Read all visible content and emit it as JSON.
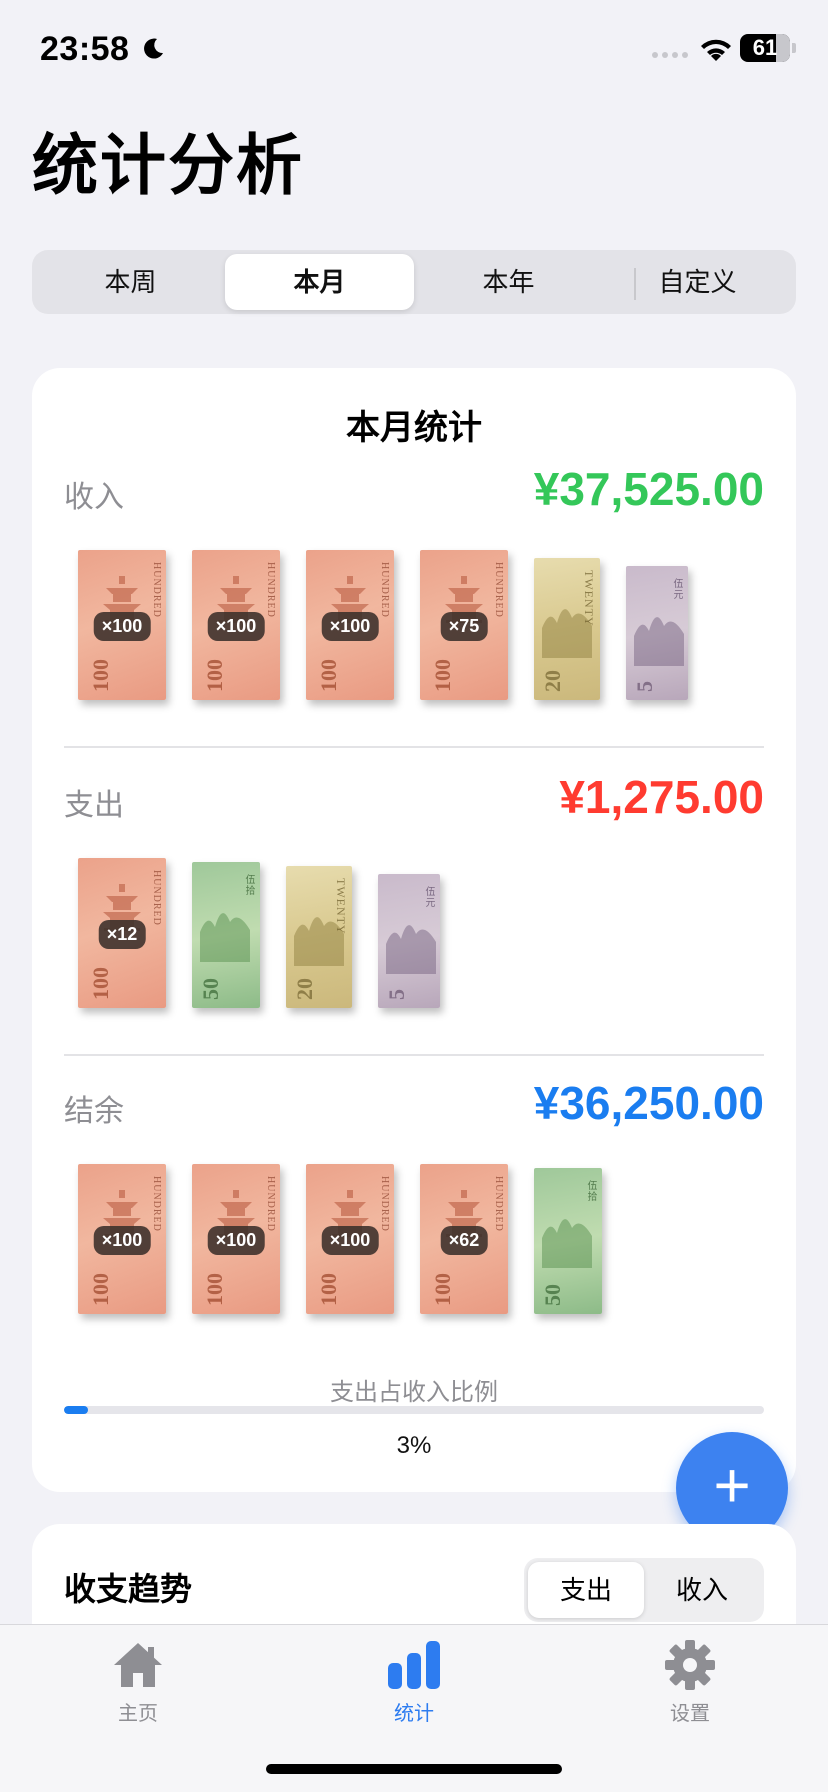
{
  "status": {
    "time": "23:58",
    "battery": "61"
  },
  "title": "统计分析",
  "segments": [
    "本周",
    "本月",
    "本年",
    "自定义"
  ],
  "active_segment": "本月",
  "summary": {
    "title": "本月统计",
    "income": {
      "label": "收入",
      "amount": "¥37,525.00",
      "color": "#34c759",
      "bills": [
        {
          "denom": "100",
          "badge": "×100"
        },
        {
          "denom": "100",
          "badge": "×100"
        },
        {
          "denom": "100",
          "badge": "×100"
        },
        {
          "denom": "100",
          "badge": "×75"
        },
        {
          "denom": "20",
          "badge": ""
        },
        {
          "denom": "5",
          "badge": ""
        }
      ]
    },
    "expense": {
      "label": "支出",
      "amount": "¥1,275.00",
      "color": "#ff3b30",
      "bills": [
        {
          "denom": "100",
          "badge": "×12"
        },
        {
          "denom": "50",
          "badge": ""
        },
        {
          "denom": "20",
          "badge": ""
        },
        {
          "denom": "5",
          "badge": ""
        }
      ]
    },
    "balance": {
      "label": "结余",
      "amount": "¥36,250.00",
      "color": "#1a7df0",
      "bills": [
        {
          "denom": "100",
          "badge": "×100"
        },
        {
          "denom": "100",
          "badge": "×100"
        },
        {
          "denom": "100",
          "badge": "×100"
        },
        {
          "denom": "100",
          "badge": "×62"
        },
        {
          "denom": "50",
          "badge": ""
        }
      ]
    },
    "ratio_label": "支出占收入比例",
    "ratio_value": "3%",
    "ratio_fraction": 0.034
  },
  "fab": {
    "icon": "plus-icon",
    "label": "+"
  },
  "trend": {
    "title": "收支趋势",
    "options": [
      "支出",
      "收入"
    ],
    "active": "支出"
  },
  "tabbar": [
    {
      "label": "主页",
      "icon": "home-icon"
    },
    {
      "label": "统计",
      "icon": "chart-bar-icon",
      "active": true
    },
    {
      "label": "设置",
      "icon": "gear-icon"
    }
  ]
}
